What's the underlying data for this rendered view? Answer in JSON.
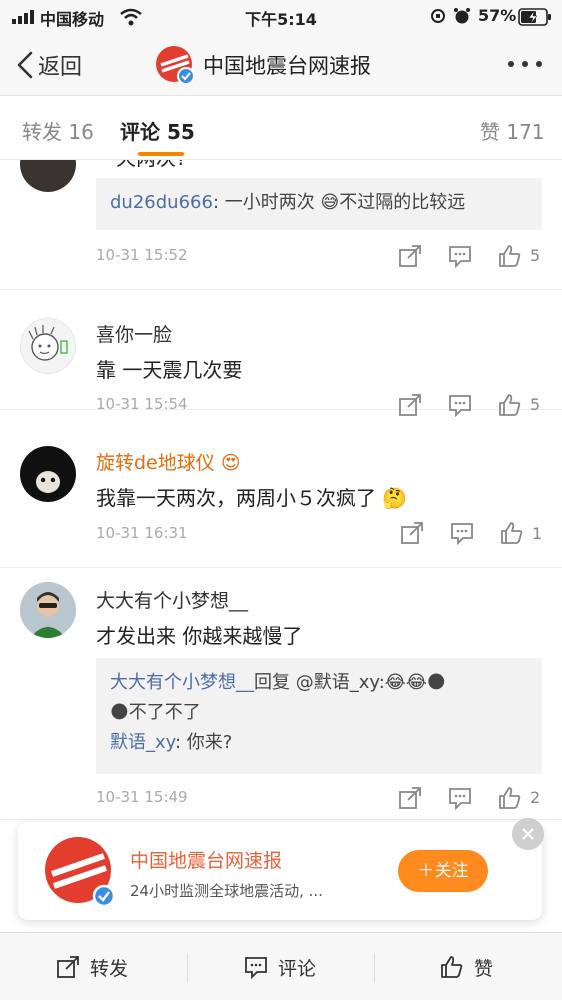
{
  "status_bar": {
    "carrier": "中国移动",
    "time": "下午5:14",
    "battery_percent": "57%"
  },
  "nav": {
    "back_label": "返回",
    "title": "中国地震台网速报",
    "more_icon": "more-dots-icon"
  },
  "tabs": {
    "repost": "转发 16",
    "comments": "评论 55",
    "likes": "赞 171"
  },
  "comments": [
    {
      "text": "一天两次?",
      "reply": {
        "name": "du26du666",
        "text": ": 一小时两次 😅不过隔的比较远"
      },
      "time": "10-31 15:52",
      "likes": "5"
    },
    {
      "username": "喜你一脸",
      "text": "靠 一天震几次要",
      "time": "10-31 15:54",
      "likes": "5"
    },
    {
      "username": "旋转de地球仪",
      "badge": "😍",
      "text": "我靠一天两次，两周小５次疯了 🤔",
      "time": "10-31 16:31",
      "likes": "1"
    },
    {
      "username": "大大有个小梦想__",
      "text": "才发出来 你越来越慢了",
      "reply_lines": [
        {
          "name": "大大有个小梦想__",
          "text": "回复 @默语_xy:😂😂🌑"
        },
        {
          "name": "",
          "text": "🌑不了不了"
        },
        {
          "name": "默语_xy",
          "text": ": 你来?"
        }
      ],
      "time": "10-31 15:49",
      "likes": "2"
    }
  ],
  "promo": {
    "name": "中国地震台网速报",
    "description": "24小时监测全球地震活动, ...",
    "follow_label": "＋关注"
  },
  "bottom_bar": {
    "repost": "转发",
    "comment": "评论",
    "like": "赞"
  },
  "colors": {
    "accent": "#ff8200",
    "link": "#4a6ea5",
    "vip_name": "#e86b0c"
  }
}
